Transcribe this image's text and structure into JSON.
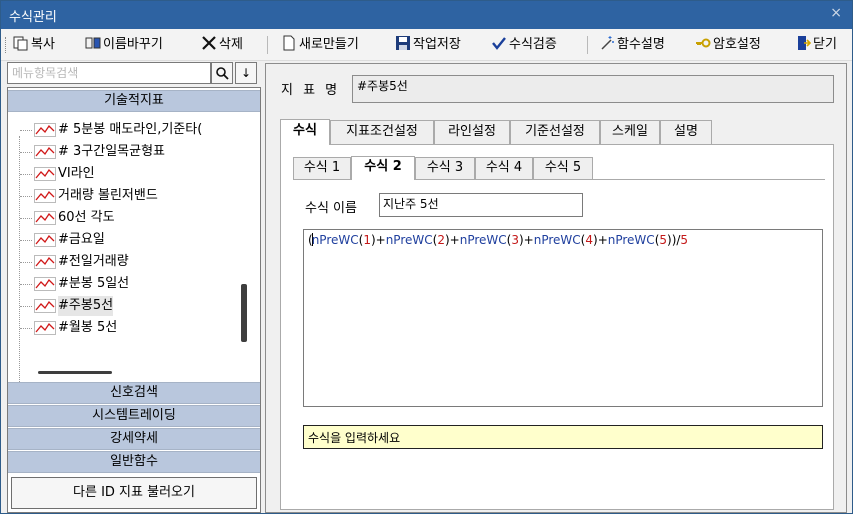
{
  "window": {
    "title": "수식관리",
    "close": "×"
  },
  "toolbar": {
    "copy": "복사",
    "rename": "이름바꾸기",
    "delete": "삭제",
    "new": "새로만들기",
    "save": "작업저장",
    "verify": "수식검증",
    "func_help": "함수설명",
    "password": "암호설정",
    "close": "닫기"
  },
  "search": {
    "placeholder": "메뉴항목검색",
    "search_btn": "🔍",
    "down_btn": "↓"
  },
  "sidebar": {
    "top_section": "기술적지표",
    "items": [
      "# 5분봉 매도라인,기준타(",
      "# 3구간일목균형표",
      "VI라인",
      "거래량 볼린저밴드",
      "60선 각도",
      "#금요일",
      "#전일거래량",
      "#분봉 5일선",
      "#주봉5선",
      "#월봉 5선"
    ],
    "selected_index": 8,
    "sections": [
      "신호검색",
      "시스템트레이딩",
      "강세약세",
      "일반함수"
    ],
    "load_other_btn": "다른 ID 지표 불러오기"
  },
  "main": {
    "name_label": "지 표 명",
    "name_value": "#주봉5선",
    "tabs": [
      "수식",
      "지표조건설정",
      "라인설정",
      "기준선설정",
      "스케일",
      "설명"
    ],
    "active_tab": 0,
    "formula_tabs": [
      "수식 1",
      "수식 2",
      "수식 3",
      "수식 4",
      "수식 5"
    ],
    "active_formula_tab": 1,
    "formula_name_label": "수식 이름",
    "formula_name_value": "지난주 5선",
    "formula_tokens": [
      {
        "t": "(",
        "c": "fp"
      },
      {
        "t": "|",
        "c": "caret"
      },
      {
        "t": "nPreWC",
        "c": "fk"
      },
      {
        "t": "(",
        "c": "fp"
      },
      {
        "t": "1",
        "c": "fn"
      },
      {
        "t": ")",
        "c": "fp"
      },
      {
        "t": "+",
        "c": "fp"
      },
      {
        "t": "nPreWC",
        "c": "fk"
      },
      {
        "t": "(",
        "c": "fp"
      },
      {
        "t": "2",
        "c": "fn"
      },
      {
        "t": ")",
        "c": "fp"
      },
      {
        "t": "+",
        "c": "fp"
      },
      {
        "t": "nPreWC",
        "c": "fk"
      },
      {
        "t": "(",
        "c": "fp"
      },
      {
        "t": "3",
        "c": "fn"
      },
      {
        "t": ")",
        "c": "fp"
      },
      {
        "t": "+",
        "c": "fp"
      },
      {
        "t": "nPreWC",
        "c": "fk"
      },
      {
        "t": "(",
        "c": "fp"
      },
      {
        "t": "4",
        "c": "fn"
      },
      {
        "t": ")",
        "c": "fp"
      },
      {
        "t": "+",
        "c": "fp"
      },
      {
        "t": "nPreWC",
        "c": "fk"
      },
      {
        "t": "(",
        "c": "fp"
      },
      {
        "t": "5",
        "c": "fn"
      },
      {
        "t": "))/",
        "c": "fp"
      },
      {
        "t": "5",
        "c": "fn"
      }
    ],
    "message": "수식을 입력하세요"
  }
}
